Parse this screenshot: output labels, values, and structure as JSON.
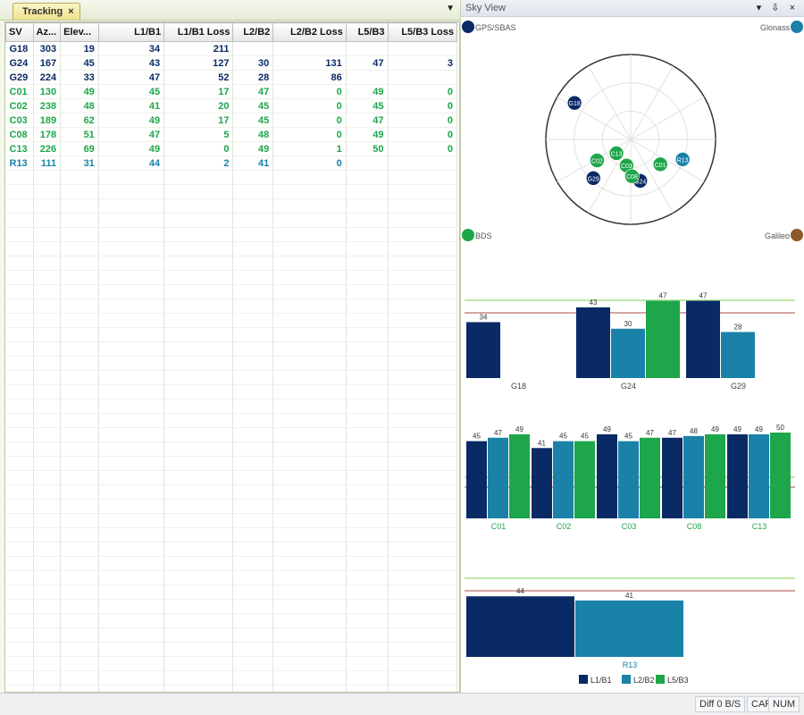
{
  "left_tab": {
    "label": "Tracking",
    "close": "×",
    "menu": "▼"
  },
  "table": {
    "headers": [
      "SV",
      "Az...",
      "Elev...",
      "L1/B1",
      "L1/B1 Loss",
      "L2/B2",
      "L2/B2 Loss",
      "L5/B3",
      "L5/B3 Loss"
    ],
    "rows": [
      {
        "cls": "gps",
        "cells": [
          "G18",
          "303",
          "19",
          "34",
          "211",
          "",
          "",
          "",
          ""
        ]
      },
      {
        "cls": "gps",
        "cells": [
          "G24",
          "167",
          "45",
          "43",
          "127",
          "30",
          "131",
          "47",
          "3"
        ]
      },
      {
        "cls": "gps",
        "cells": [
          "G29",
          "224",
          "33",
          "47",
          "52",
          "28",
          "86",
          "",
          ""
        ]
      },
      {
        "cls": "bds",
        "cells": [
          "C01",
          "130",
          "49",
          "45",
          "17",
          "47",
          "0",
          "49",
          "0"
        ]
      },
      {
        "cls": "bds",
        "cells": [
          "C02",
          "238",
          "48",
          "41",
          "20",
          "45",
          "0",
          "45",
          "0"
        ]
      },
      {
        "cls": "bds",
        "cells": [
          "C03",
          "189",
          "62",
          "49",
          "17",
          "45",
          "0",
          "47",
          "0"
        ]
      },
      {
        "cls": "bds",
        "cells": [
          "C08",
          "178",
          "51",
          "47",
          "5",
          "48",
          "0",
          "49",
          "0"
        ]
      },
      {
        "cls": "bds",
        "cells": [
          "C13",
          "226",
          "69",
          "49",
          "0",
          "49",
          "1",
          "50",
          "0"
        ]
      },
      {
        "cls": "glo",
        "cells": [
          "R13",
          "111",
          "31",
          "44",
          "2",
          "41",
          "0",
          "",
          ""
        ]
      }
    ]
  },
  "sky_view": {
    "title": "Sky View",
    "controls": "▾ ⇩ ×",
    "constellations": [
      {
        "name": "GPS/SBAS",
        "color": "#0a2a66"
      },
      {
        "name": "Glonass",
        "color": "#1a82a8"
      },
      {
        "name": "BDS",
        "color": "#1ea64a"
      },
      {
        "name": "Galileo",
        "color": "#8b5a2b"
      }
    ],
    "satellites": [
      {
        "id": "G18",
        "az": 303,
        "el": 19,
        "sys": "gps"
      },
      {
        "id": "G24",
        "az": 167,
        "el": 45,
        "sys": "gps"
      },
      {
        "id": "G29",
        "az": 224,
        "el": 33,
        "sys": "gps"
      },
      {
        "id": "C01",
        "az": 130,
        "el": 49,
        "sys": "bds"
      },
      {
        "id": "C02",
        "az": 238,
        "el": 48,
        "sys": "bds"
      },
      {
        "id": "C03",
        "az": 189,
        "el": 62,
        "sys": "bds"
      },
      {
        "id": "C08",
        "az": 178,
        "el": 51,
        "sys": "bds"
      },
      {
        "id": "C13",
        "az": 226,
        "el": 69,
        "sys": "bds"
      },
      {
        "id": "R13",
        "az": 111,
        "el": 31,
        "sys": "glo"
      }
    ]
  },
  "colors": {
    "l1": "#0a2a66",
    "l2": "#1a82a8",
    "l5": "#1ea64a",
    "gps": "#0a2a66",
    "bds": "#1ea64a",
    "glo": "#1a82a8",
    "green_line": "#a6e08a",
    "red_line": "#c98686"
  },
  "chart_data": [
    {
      "type": "bar",
      "group": "GPS",
      "categories": [
        "G18",
        "G24",
        "G29"
      ],
      "series": [
        {
          "name": "L1/B1",
          "values": [
            34,
            43,
            47
          ]
        },
        {
          "name": "L2/B2",
          "values": [
            null,
            30,
            28
          ]
        },
        {
          "name": "L5/B3",
          "values": [
            null,
            47,
            null
          ]
        }
      ],
      "ylim": [
        0,
        50
      ]
    },
    {
      "type": "bar",
      "group": "BDS",
      "categories": [
        "C01",
        "C02",
        "C03",
        "C08",
        "C13"
      ],
      "series": [
        {
          "name": "L1/B1",
          "values": [
            45,
            41,
            49,
            47,
            49
          ]
        },
        {
          "name": "L2/B2",
          "values": [
            47,
            45,
            45,
            48,
            49
          ]
        },
        {
          "name": "L5/B3",
          "values": [
            49,
            45,
            47,
            49,
            50
          ]
        }
      ],
      "ylim": [
        0,
        50
      ]
    },
    {
      "type": "bar",
      "group": "Glonass",
      "categories": [
        "R13"
      ],
      "series": [
        {
          "name": "L1/B1",
          "values": [
            44
          ]
        },
        {
          "name": "L2/B2",
          "values": [
            41
          ]
        },
        {
          "name": "L5/B3",
          "values": [
            null
          ]
        }
      ],
      "ylim": [
        0,
        50
      ]
    }
  ],
  "legend": [
    "L1/B1",
    "L2/B2",
    "L5/B3"
  ],
  "status": {
    "diff": "Diff 0 B/S",
    "cap": "CAP",
    "num": "NUM"
  }
}
